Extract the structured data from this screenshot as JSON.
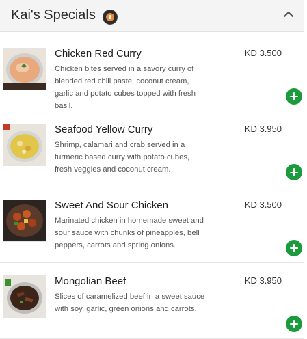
{
  "header": {
    "title": "Kai's Specials",
    "badge_icon": "chef-badge-icon",
    "collapse_icon": "chevron-up-icon"
  },
  "items": [
    {
      "name": "Chicken Red Curry",
      "price": "KD 3.500",
      "description": "Chicken bites served in a savory curry of blended red chili paste, coconut cream, garlic and potato cubes topped with fresh basil.",
      "image": "chicken-red-curry-photo"
    },
    {
      "name": "Seafood Yellow Curry",
      "price": "KD 3.950",
      "description": "Shrimp, calamari and crab served in a turmeric based curry with potato cubes, fresh veggies and coconut cream.",
      "image": "seafood-yellow-curry-photo"
    },
    {
      "name": "Sweet And Sour Chicken",
      "price": "KD 3.500",
      "description": "Marinated chicken in homemade sweet and sour sauce with chunks of pineapples, bell peppers, carrots and spring onions.",
      "image": "sweet-sour-chicken-photo"
    },
    {
      "name": "Mongolian Beef",
      "price": "KD 3.950",
      "description": "Slices of caramelized beef in a sweet sauce with soy, garlic, green onions and carrots.",
      "image": "mongolian-beef-photo"
    }
  ],
  "colors": {
    "accent": "#1c9a3e",
    "header_bg": "#f4f4f4"
  }
}
